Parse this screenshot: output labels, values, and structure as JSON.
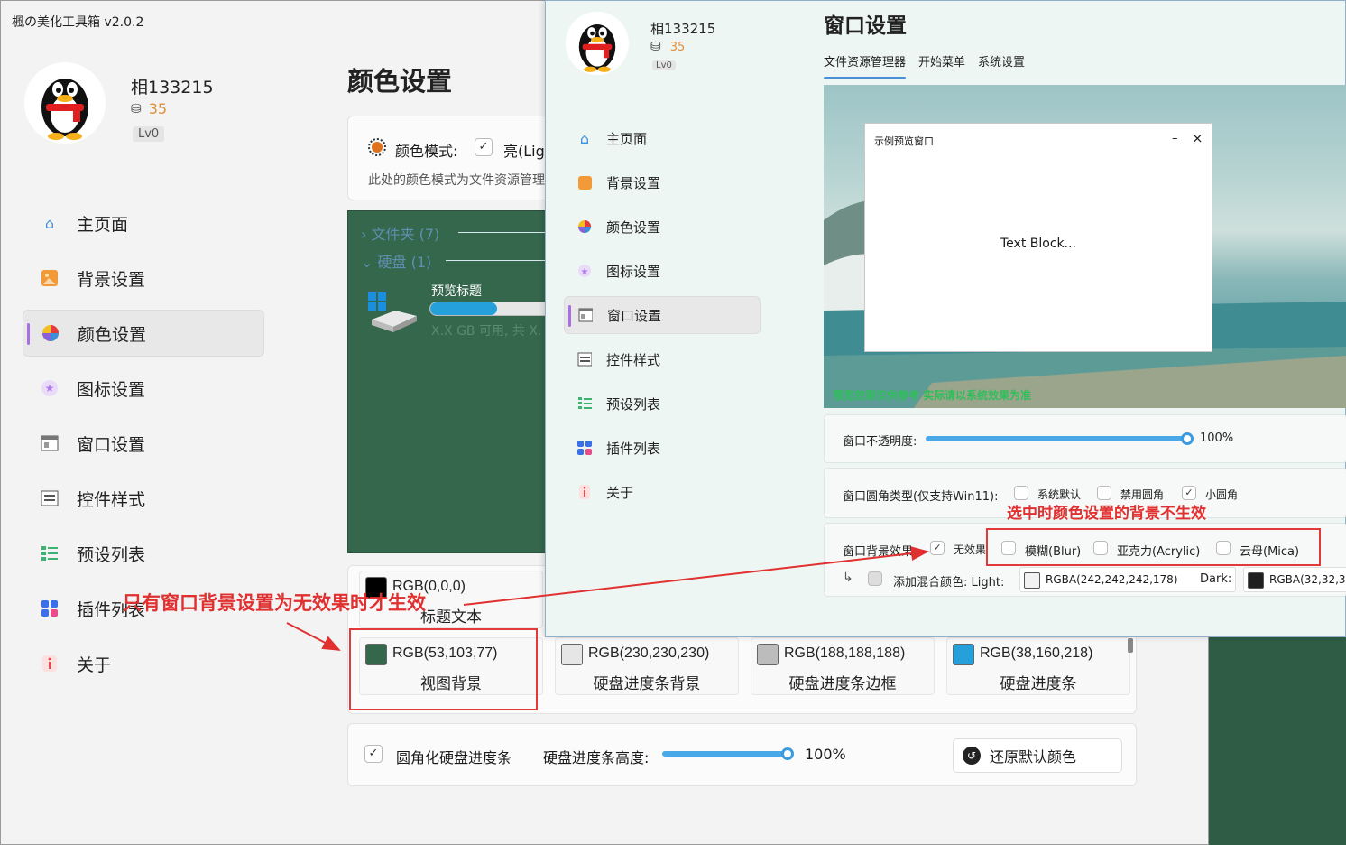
{
  "main_window": {
    "title": "楓の美化工具箱 v2.0.2",
    "user": {
      "name": "相133215",
      "coins": "35",
      "level": "Lv0"
    },
    "nav": [
      {
        "label": "主页面",
        "icon": "home-icon"
      },
      {
        "label": "背景设置",
        "icon": "image-icon"
      },
      {
        "label": "颜色设置",
        "icon": "palette-icon"
      },
      {
        "label": "图标设置",
        "icon": "star-icon"
      },
      {
        "label": "窗口设置",
        "icon": "window-icon"
      },
      {
        "label": "控件样式",
        "icon": "controls-icon"
      },
      {
        "label": "预设列表",
        "icon": "list-icon"
      },
      {
        "label": "插件列表",
        "icon": "plugins-icon"
      },
      {
        "label": "关于",
        "icon": "info-icon"
      }
    ],
    "page_title": "颜色设置",
    "color_mode": {
      "label": "颜色模式:",
      "value": "亮(Lig",
      "desc": "此处的颜色模式为文件资源管理"
    },
    "preview": {
      "folder": "文件夹 (7)",
      "disk": "硬盘 (1)",
      "disk_title": "预览标题",
      "disk_info": "X.X GB 可用, 共 X."
    },
    "swatches": [
      {
        "rgb": "RGB(0,0,0)",
        "name": "标题文本",
        "color": "#000000"
      },
      {
        "rgb": "RGB(53,103,77)",
        "name": "视图背景",
        "color": "#35674d"
      },
      {
        "rgb": "RGB(230,230,230)",
        "name": "硬盘进度条背景",
        "color": "#e6e6e6"
      },
      {
        "rgb": "RGB(188,188,188)",
        "name": "硬盘进度条边框",
        "color": "#bcbcbc"
      },
      {
        "rgb": "RGB(38,160,218)",
        "name": "硬盘进度条",
        "color": "#26a0da"
      }
    ],
    "bottom": {
      "round_label": "圆角化硬盘进度条",
      "height_label": "硬盘进度条高度:",
      "height_value": "100%",
      "restore_label": "还原默认颜色"
    }
  },
  "second_window": {
    "user": {
      "name": "相133215",
      "coins": "35",
      "level": "Lv0"
    },
    "nav": [
      {
        "label": "主页面",
        "icon": "home-icon"
      },
      {
        "label": "背景设置",
        "icon": "image-icon"
      },
      {
        "label": "颜色设置",
        "icon": "palette-icon"
      },
      {
        "label": "图标设置",
        "icon": "star-icon"
      },
      {
        "label": "窗口设置",
        "icon": "window-icon"
      },
      {
        "label": "控件样式",
        "icon": "controls-icon"
      },
      {
        "label": "预设列表",
        "icon": "list-icon"
      },
      {
        "label": "插件列表",
        "icon": "plugins-icon"
      },
      {
        "label": "关于",
        "icon": "info-icon"
      }
    ],
    "page_title": "窗口设置",
    "tabs": [
      "文件资源管理器",
      "开始菜单",
      "系统设置"
    ],
    "demo_window": {
      "title": "示例预览窗口",
      "body": "Text Block...",
      "minimize": "–",
      "close": "×"
    },
    "preview_note": "预览效果仅供参考 实际请以系统效果为准",
    "opacity": {
      "label": "窗口不透明度:",
      "value": "100%"
    },
    "corner": {
      "label": "窗口圆角类型(仅支持Win11):",
      "options": [
        "系统默认",
        "禁用圆角",
        "小圆角"
      ]
    },
    "backdrop": {
      "label": "窗口背景效果:",
      "options": [
        "无效果",
        "模糊(Blur)",
        "亚克力(Acrylic)",
        "云母(Mica)"
      ]
    },
    "blend": {
      "label": "添加混合颜色: Light:",
      "light": "RGBA(242,242,242,178)",
      "dark_label": "Dark:",
      "dark": "RGBA(32,32,3"
    }
  },
  "annotations": {
    "left": "只有窗口背景设置为无效果时才生效",
    "right": "选中时颜色设置的背景不生效"
  }
}
